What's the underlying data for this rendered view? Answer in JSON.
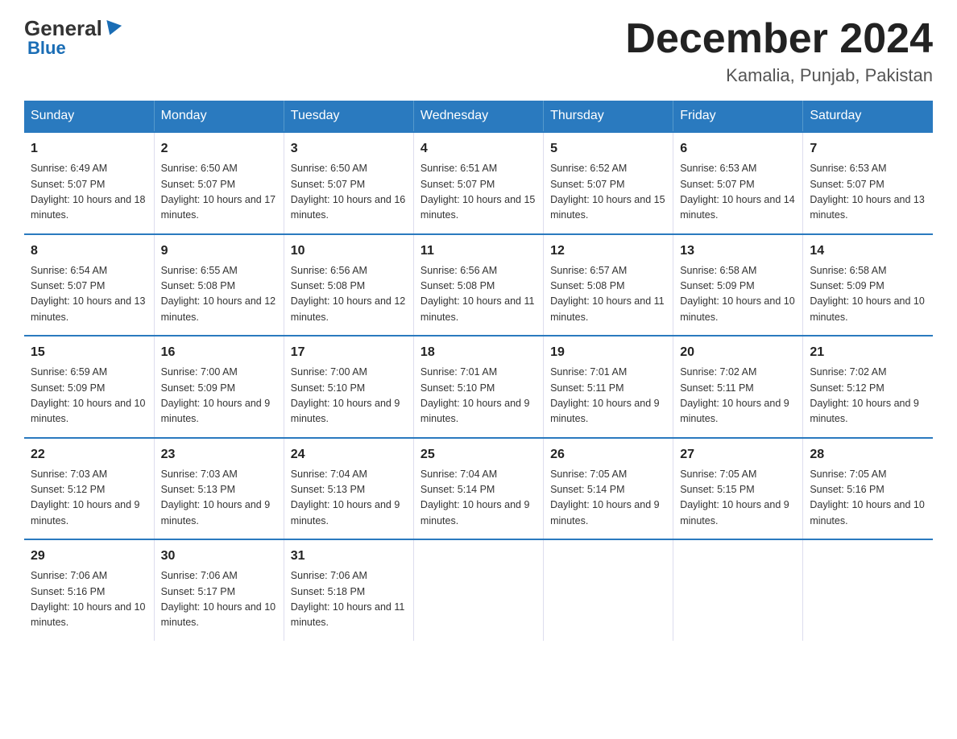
{
  "logo": {
    "general": "General",
    "blue": "Blue"
  },
  "title": "December 2024",
  "location": "Kamalia, Punjab, Pakistan",
  "days_of_week": [
    "Sunday",
    "Monday",
    "Tuesday",
    "Wednesday",
    "Thursday",
    "Friday",
    "Saturday"
  ],
  "weeks": [
    [
      {
        "day": 1,
        "sunrise": "6:49 AM",
        "sunset": "5:07 PM",
        "daylight": "10 hours and 18 minutes."
      },
      {
        "day": 2,
        "sunrise": "6:50 AM",
        "sunset": "5:07 PM",
        "daylight": "10 hours and 17 minutes."
      },
      {
        "day": 3,
        "sunrise": "6:50 AM",
        "sunset": "5:07 PM",
        "daylight": "10 hours and 16 minutes."
      },
      {
        "day": 4,
        "sunrise": "6:51 AM",
        "sunset": "5:07 PM",
        "daylight": "10 hours and 15 minutes."
      },
      {
        "day": 5,
        "sunrise": "6:52 AM",
        "sunset": "5:07 PM",
        "daylight": "10 hours and 15 minutes."
      },
      {
        "day": 6,
        "sunrise": "6:53 AM",
        "sunset": "5:07 PM",
        "daylight": "10 hours and 14 minutes."
      },
      {
        "day": 7,
        "sunrise": "6:53 AM",
        "sunset": "5:07 PM",
        "daylight": "10 hours and 13 minutes."
      }
    ],
    [
      {
        "day": 8,
        "sunrise": "6:54 AM",
        "sunset": "5:07 PM",
        "daylight": "10 hours and 13 minutes."
      },
      {
        "day": 9,
        "sunrise": "6:55 AM",
        "sunset": "5:08 PM",
        "daylight": "10 hours and 12 minutes."
      },
      {
        "day": 10,
        "sunrise": "6:56 AM",
        "sunset": "5:08 PM",
        "daylight": "10 hours and 12 minutes."
      },
      {
        "day": 11,
        "sunrise": "6:56 AM",
        "sunset": "5:08 PM",
        "daylight": "10 hours and 11 minutes."
      },
      {
        "day": 12,
        "sunrise": "6:57 AM",
        "sunset": "5:08 PM",
        "daylight": "10 hours and 11 minutes."
      },
      {
        "day": 13,
        "sunrise": "6:58 AM",
        "sunset": "5:09 PM",
        "daylight": "10 hours and 10 minutes."
      },
      {
        "day": 14,
        "sunrise": "6:58 AM",
        "sunset": "5:09 PM",
        "daylight": "10 hours and 10 minutes."
      }
    ],
    [
      {
        "day": 15,
        "sunrise": "6:59 AM",
        "sunset": "5:09 PM",
        "daylight": "10 hours and 10 minutes."
      },
      {
        "day": 16,
        "sunrise": "7:00 AM",
        "sunset": "5:09 PM",
        "daylight": "10 hours and 9 minutes."
      },
      {
        "day": 17,
        "sunrise": "7:00 AM",
        "sunset": "5:10 PM",
        "daylight": "10 hours and 9 minutes."
      },
      {
        "day": 18,
        "sunrise": "7:01 AM",
        "sunset": "5:10 PM",
        "daylight": "10 hours and 9 minutes."
      },
      {
        "day": 19,
        "sunrise": "7:01 AM",
        "sunset": "5:11 PM",
        "daylight": "10 hours and 9 minutes."
      },
      {
        "day": 20,
        "sunrise": "7:02 AM",
        "sunset": "5:11 PM",
        "daylight": "10 hours and 9 minutes."
      },
      {
        "day": 21,
        "sunrise": "7:02 AM",
        "sunset": "5:12 PM",
        "daylight": "10 hours and 9 minutes."
      }
    ],
    [
      {
        "day": 22,
        "sunrise": "7:03 AM",
        "sunset": "5:12 PM",
        "daylight": "10 hours and 9 minutes."
      },
      {
        "day": 23,
        "sunrise": "7:03 AM",
        "sunset": "5:13 PM",
        "daylight": "10 hours and 9 minutes."
      },
      {
        "day": 24,
        "sunrise": "7:04 AM",
        "sunset": "5:13 PM",
        "daylight": "10 hours and 9 minutes."
      },
      {
        "day": 25,
        "sunrise": "7:04 AM",
        "sunset": "5:14 PM",
        "daylight": "10 hours and 9 minutes."
      },
      {
        "day": 26,
        "sunrise": "7:05 AM",
        "sunset": "5:14 PM",
        "daylight": "10 hours and 9 minutes."
      },
      {
        "day": 27,
        "sunrise": "7:05 AM",
        "sunset": "5:15 PM",
        "daylight": "10 hours and 9 minutes."
      },
      {
        "day": 28,
        "sunrise": "7:05 AM",
        "sunset": "5:16 PM",
        "daylight": "10 hours and 10 minutes."
      }
    ],
    [
      {
        "day": 29,
        "sunrise": "7:06 AM",
        "sunset": "5:16 PM",
        "daylight": "10 hours and 10 minutes."
      },
      {
        "day": 30,
        "sunrise": "7:06 AM",
        "sunset": "5:17 PM",
        "daylight": "10 hours and 10 minutes."
      },
      {
        "day": 31,
        "sunrise": "7:06 AM",
        "sunset": "5:18 PM",
        "daylight": "10 hours and 11 minutes."
      },
      null,
      null,
      null,
      null
    ]
  ]
}
